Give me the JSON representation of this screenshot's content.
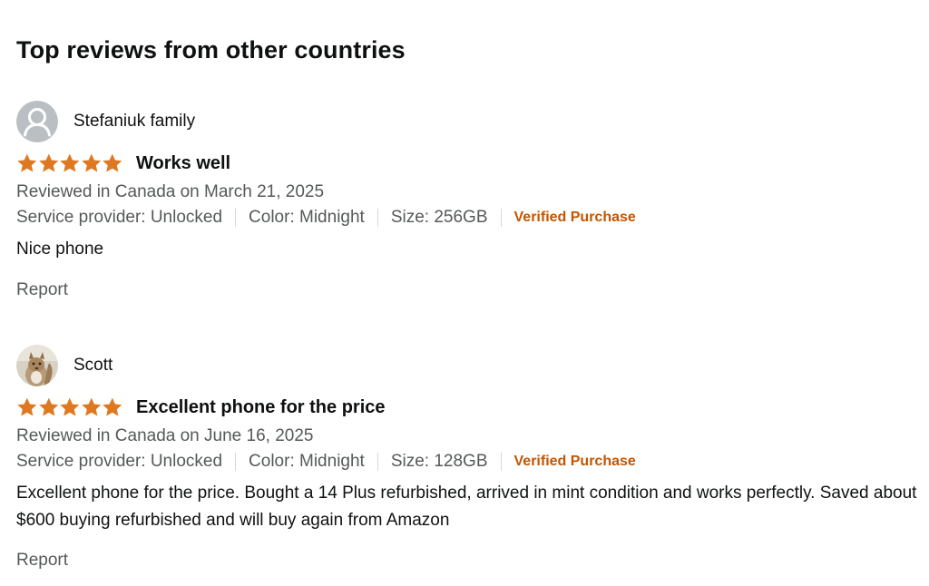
{
  "section": {
    "title": "Top reviews from other countries"
  },
  "colors": {
    "star": "#de7921",
    "verified": "#c45500",
    "secondary_text": "#565959",
    "primary_text": "#0f1111"
  },
  "reviews": [
    {
      "author": "Stefaniuk family",
      "avatar_icon": "default-user-avatar-icon",
      "rating": 5,
      "rating_max": 5,
      "title": "Works well",
      "date": "Reviewed in Canada on March 21, 2025",
      "service_provider": "Service provider: Unlocked",
      "color": "Color: Midnight",
      "size": "Size: 256GB",
      "verified": "Verified Purchase",
      "body": "Nice phone",
      "report": "Report"
    },
    {
      "author": "Scott",
      "avatar_icon": "squirrel-photo-avatar-icon",
      "rating": 5,
      "rating_max": 5,
      "title": "Excellent phone for the price",
      "date": "Reviewed in Canada on June 16, 2025",
      "service_provider": "Service provider: Unlocked",
      "color": "Color: Midnight",
      "size": "Size: 128GB",
      "verified": "Verified Purchase",
      "body": "Excellent phone for the price. Bought a 14 Plus refurbished, arrived in mint condition and works perfectly. Saved about $600 buying refurbished and will buy again from Amazon",
      "report": "Report"
    }
  ]
}
